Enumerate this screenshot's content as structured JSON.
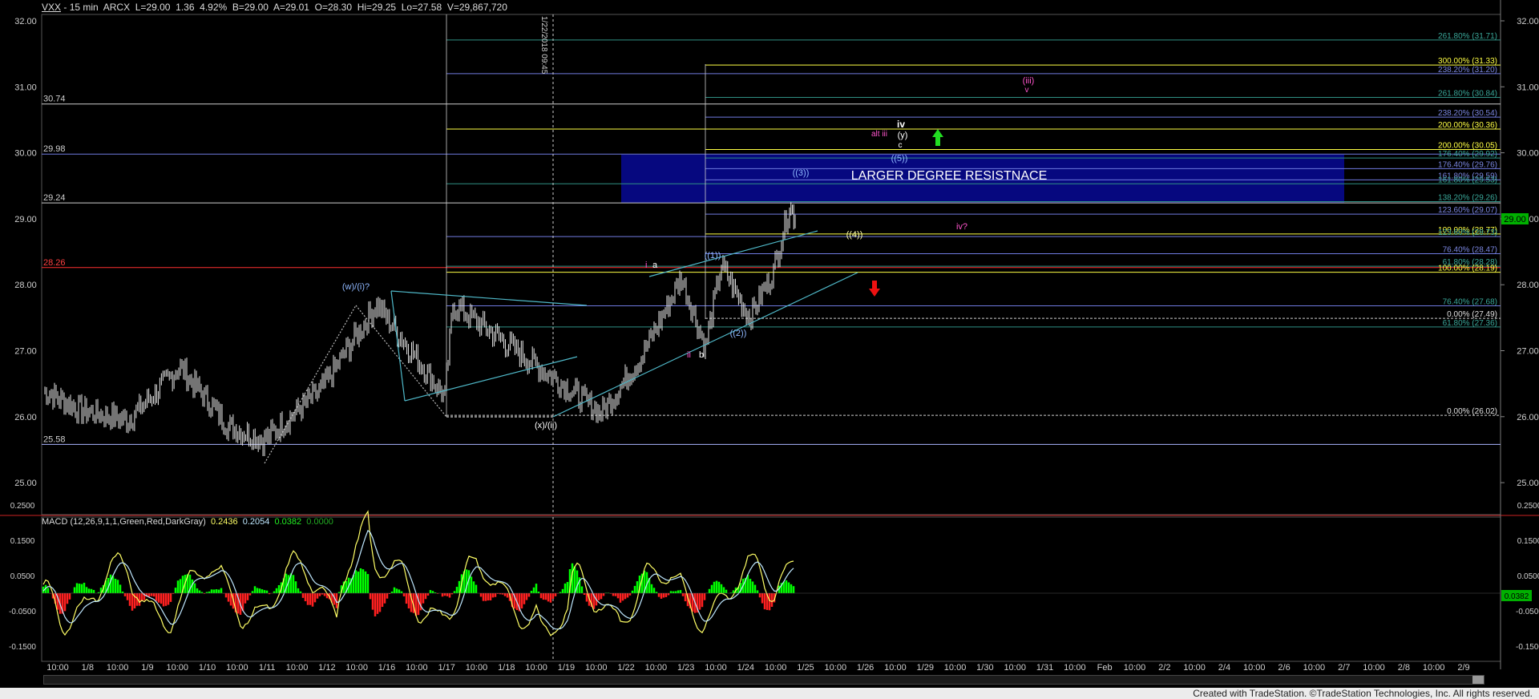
{
  "header": {
    "symbol": "VXX",
    "interval": "15 min",
    "exchange": "ARCX",
    "last": "L=29.00",
    "change": "1.36",
    "change_pct": "4.92%",
    "bid": "B=29.00",
    "ask": "A=29.01",
    "open": "O=28.30",
    "high": "Hi=29.25",
    "low": "Lo=27.58",
    "volume": "V=29,867,720"
  },
  "price_axis": {
    "ticks": [
      "32.00",
      "31.00",
      "30.00",
      "29.00",
      "28.00",
      "27.00",
      "26.00",
      "25.00"
    ],
    "last_price_tag": "29.00",
    "last_price_color": "#00c800"
  },
  "date_axis": {
    "labels": [
      "10:00",
      "1/8",
      "10:00",
      "1/9",
      "10:00",
      "1/10",
      "10:00",
      "1/11",
      "10:00",
      "1/12",
      "10:00",
      "1/16",
      "10:00",
      "1/17",
      "10:00",
      "1/18",
      "10:00",
      "1/19",
      "10:00",
      "1/22",
      "10:00",
      "1/23",
      "10:00",
      "1/24",
      "10:00",
      "1/25",
      "10:00",
      "1/26",
      "10:00",
      "1/29",
      "10:00",
      "1/30",
      "10:00",
      "1/31",
      "10:00",
      "Feb",
      "10:00",
      "2/2",
      "10:00",
      "2/4",
      "10:00",
      "2/6",
      "10:00",
      "2/7",
      "10:00",
      "2/8",
      "10:00",
      "2/9"
    ]
  },
  "left_level_labels": [
    {
      "text": "30.74",
      "color": "#cfcfcf"
    },
    {
      "text": "29.98",
      "color": "#cfcfcf"
    },
    {
      "text": "29.24",
      "color": "#cfcfcf"
    },
    {
      "text": "28.26",
      "color": "#ff4040"
    },
    {
      "text": "25.58",
      "color": "#cfcfcf"
    }
  ],
  "fib_labels": [
    {
      "text": "261.80% (31.71)",
      "color": "#3aa89a"
    },
    {
      "text": "300.00% (31.33)",
      "color": "#ffff44"
    },
    {
      "text": "238.20% (31.20)",
      "color": "#7a86e0"
    },
    {
      "text": "261.80% (30.84)",
      "color": "#3aa89a"
    },
    {
      "text": "238.20% (30.54)",
      "color": "#7a86e0"
    },
    {
      "text": "200.00% (30.36)",
      "color": "#ffff44"
    },
    {
      "text": "200.00% (30.05)",
      "color": "#ffff44"
    },
    {
      "text": "176.40% (29.92)",
      "color": "#3aa89a"
    },
    {
      "text": "176.40% (29.76)",
      "color": "#7a86e0"
    },
    {
      "text": "161.80% (29.59)",
      "color": "#7a86e0"
    },
    {
      "text": "161.80% (29.53)",
      "color": "#3aa89a"
    },
    {
      "text": "138.20% (29.26)",
      "color": "#3aa89a"
    },
    {
      "text": "123.60% (29.07)",
      "color": "#7a86e0"
    },
    {
      "text": "100.00% (28.77)",
      "color": "#ffff44"
    },
    {
      "text": "123.60% (28.73)",
      "color": "#3aa89a"
    },
    {
      "text": "76.40% (28.47)",
      "color": "#7a86e0"
    },
    {
      "text": "61.80% (28.28)",
      "color": "#3aa89a"
    },
    {
      "text": "100.00% (28.19)",
      "color": "#ffff44"
    },
    {
      "text": "76.40% (27.68)",
      "color": "#3aa89a"
    },
    {
      "text": "0.00% (27.49)",
      "color": "#e0e0e0"
    },
    {
      "text": "61.80% (27.36)",
      "color": "#3aa89a"
    },
    {
      "text": "0.00% (26.02)",
      "color": "#e0e0e0"
    }
  ],
  "annotations": {
    "resistance_zone": "LARGER DEGREE RESISTNACE",
    "date_marker": "1/22/2018 09:45",
    "wave_w_i": "(w)/(i)?",
    "wave_x_ii": "(x)/(ii)",
    "wave_i_a_roman": "i",
    "wave_a": "a",
    "wave_1": "((1))",
    "wave_2": "((2))",
    "wave_ii": "ii",
    "wave_b": "b",
    "wave_3": "((3))",
    "wave_4": "((4))",
    "wave_5": "((5))",
    "wave_iv_upper": "iv",
    "wave_alt_iii": "alt iii",
    "wave_y": "(y)",
    "wave_c": "c",
    "wave_iii_paren": "(iii)",
    "wave_v": "v",
    "wave_iv_q": "iv?"
  },
  "macd": {
    "label": "MACD (12,26,9,1,1,Green,Red,DarkGray)",
    "v1": "0.2436",
    "v2": "0.2054",
    "v3": "0.0382",
    "v4": "0.0000",
    "ticks": [
      "0.2500",
      "0.1500",
      "0.0500",
      "-0.0500",
      "-0.1500"
    ],
    "value_tag": "0.0382",
    "colors": {
      "macd": "#ffff66",
      "signal": "#bfe8ff",
      "hist_pos": "#00ff00",
      "hist_neg": "#ff2020"
    }
  },
  "chart_data": {
    "type": "candlestick",
    "title": "VXX - 15 min ARCX",
    "ylim": [
      24.6,
      32.2
    ],
    "x_labels": [
      "1/8",
      "1/9",
      "1/10",
      "1/11",
      "1/12",
      "1/16",
      "1/17",
      "1/18",
      "1/19",
      "1/22",
      "1/23",
      "1/24",
      "1/25",
      "1/26",
      "1/29"
    ],
    "approx_session_path": [
      {
        "date": "1/5",
        "price": 26.4
      },
      {
        "date": "1/8",
        "price": 26.1
      },
      {
        "date": "1/9",
        "price": 25.95
      },
      {
        "date": "1/10",
        "price": 26.75
      },
      {
        "date": "1/11",
        "price": 25.85
      },
      {
        "date": "1/12",
        "price": 25.65
      },
      {
        "date": "1/16",
        "price": 26.4
      },
      {
        "date": "1/16",
        "price": 27.7
      },
      {
        "date": "1/17",
        "price": 26.3
      },
      {
        "date": "1/18",
        "price": 27.7
      },
      {
        "date": "1/19",
        "price": 26.6
      },
      {
        "date": "1/22",
        "price": 26.05
      },
      {
        "date": "1/23",
        "price": 26.9
      },
      {
        "date": "1/24",
        "price": 28.1
      },
      {
        "date": "1/25",
        "price": 27.05
      },
      {
        "date": "1/25",
        "price": 28.3
      },
      {
        "date": "1/26",
        "price": 27.5
      },
      {
        "date": "1/29",
        "price": 28.2
      },
      {
        "date": "1/29",
        "price": 29.2
      },
      {
        "date": "1/29",
        "price": 29.0
      }
    ],
    "levels": [
      31.71,
      31.33,
      31.2,
      30.84,
      30.74,
      30.54,
      30.36,
      30.05,
      29.98,
      29.92,
      29.76,
      29.59,
      29.53,
      29.26,
      29.24,
      29.07,
      28.77,
      28.73,
      28.47,
      28.28,
      28.26,
      28.19,
      27.68,
      27.49,
      27.36,
      26.02,
      25.58
    ],
    "macd_range": [
      -0.2,
      0.3
    ]
  }
}
